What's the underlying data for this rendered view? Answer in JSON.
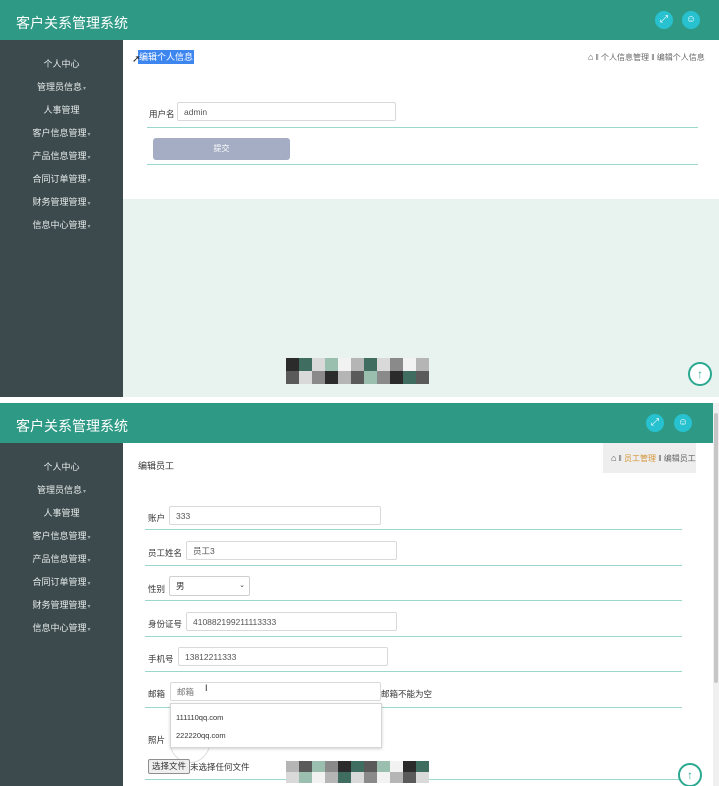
{
  "app": {
    "title": "客户关系管理系统",
    "header_icons": [
      "fullscreen-icon",
      "user-icon"
    ],
    "accent": "#2e9a85",
    "sidebar_bg": "#3d4a4d"
  },
  "sidebar": {
    "items": [
      {
        "label": "个人中心",
        "caret": false
      },
      {
        "label": "管理员信息",
        "caret": true
      },
      {
        "label": "人事管理",
        "caret": false
      },
      {
        "label": "客户信息管理",
        "caret": true
      },
      {
        "label": "产品信息管理",
        "caret": true
      },
      {
        "label": "合同订单管理",
        "caret": true
      },
      {
        "label": "财务管理管理",
        "caret": true
      },
      {
        "label": "信息中心管理",
        "caret": true
      }
    ],
    "caret_glyph": "▾"
  },
  "screen1": {
    "page_title": "编辑个人信息",
    "breadcrumb": {
      "sep": "‖",
      "items": [
        "个人信息管理",
        "编辑个人信息"
      ]
    },
    "form": {
      "username_label": "用户名",
      "username_value": "admin",
      "submit_label": "提交"
    }
  },
  "screen2": {
    "page_title": "编辑员工",
    "breadcrumb": {
      "sep": "‖",
      "items": [
        "员工管理",
        "编辑员工"
      ]
    },
    "form": {
      "account_label": "账户",
      "account_value": "333",
      "name_label": "员工姓名",
      "name_value": "员工3",
      "gender_label": "性别",
      "gender_value": "男",
      "id_label": "身份证号",
      "id_value": "410882199211113333",
      "phone_label": "手机号",
      "phone_value": "13812211333",
      "email_label": "邮箱",
      "email_placeholder": "邮箱",
      "email_error": "邮箱不能为空",
      "email_suggestions": [
        "111110qq.com",
        "222220qq.com"
      ],
      "photo_label": "照片",
      "file_button": "选择文件",
      "file_status": "未选择任何文件"
    }
  }
}
